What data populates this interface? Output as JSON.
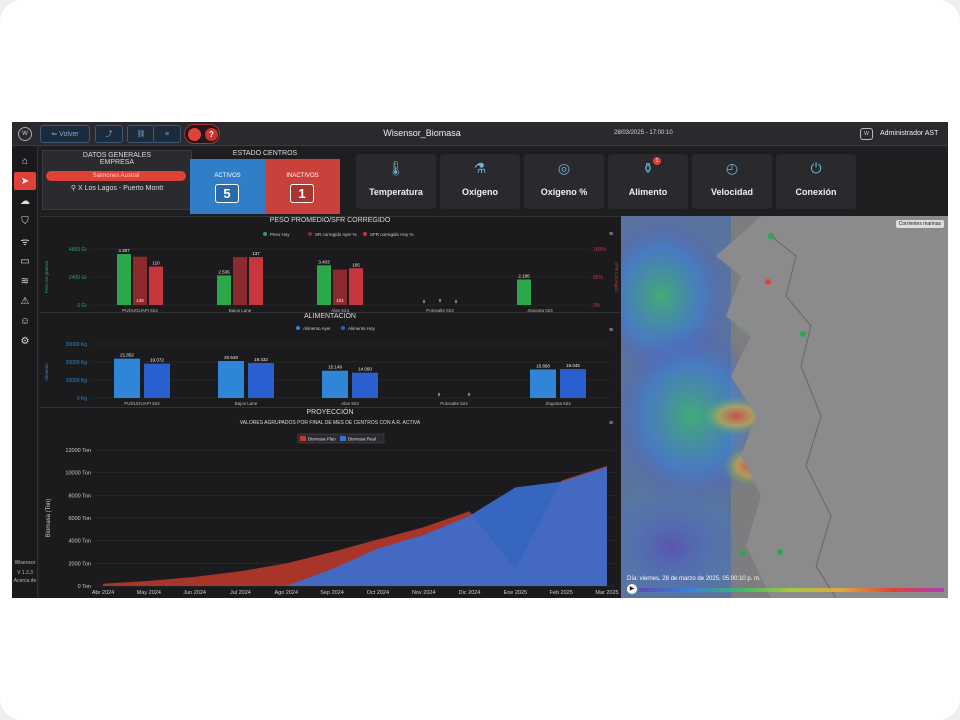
{
  "topbar": {
    "back_label": "Volver",
    "app_title": "Wisensor_Biomasa",
    "datetime": "28/03/2025 - 17:00:10",
    "user_name": "Administrador AST"
  },
  "sidebar": {
    "version_app": "Wisensor",
    "version_num": "V 1.3.3",
    "about": "Acerca de"
  },
  "datos_generales": {
    "title": "DATOS GENERALES",
    "empresa_label": "EMPRESA",
    "empresa_value": "Salmones Austral",
    "ubicacion": "X Los Lagos - Puerto Montt"
  },
  "estado_centros": {
    "title": "ESTADO CENTROS",
    "activos_label": "ACTIVOS",
    "activos_value": "5",
    "inactivos_label": "INACTIVOS",
    "inactivos_value": "1"
  },
  "sensors": [
    {
      "label": "Temperatura",
      "icon": "thermometer-icon"
    },
    {
      "label": "Oxígeno",
      "icon": "oxygen-tank-icon"
    },
    {
      "label": "Oxígeno %",
      "icon": "oxygen-percent-icon"
    },
    {
      "label": "Alimento",
      "icon": "feed-icon",
      "badge": "1"
    },
    {
      "label": "Velocidad",
      "icon": "speed-icon"
    },
    {
      "label": "Conexión",
      "icon": "power-icon"
    }
  ],
  "peso_chart": {
    "title": "PESO PROMEDIO/SFR CORREGIDO",
    "legend": [
      "Peso Hoy",
      "SR corregido Ayer %",
      "SFR corregido Hoy %"
    ],
    "y_left_ticks": [
      "4800 Gr",
      "2400 Gr",
      "0 Gr"
    ],
    "y_right_ticks": [
      "160%",
      "80%",
      "0%"
    ],
    "y_left_label": "Peso en gramos",
    "y_right_label": "SFR Corregido"
  },
  "alimentacion_chart": {
    "title": "ALIMENTACIÓN",
    "legend": [
      "Alimento Ayer",
      "Alimento Hoy"
    ],
    "y_ticks": [
      "30000 Kg",
      "20000 Kg",
      "10000 Kg",
      "0 Kg"
    ],
    "y_label": "Alimento"
  },
  "proyeccion_chart": {
    "title": "PROYECCIÓN",
    "subtitle": "VALORES AGRUPADOS POR FINAL DE MES DE CENTROS CON A.R. ACTIVA",
    "legend": [
      "Biomasa Plan",
      "Biomasa Real"
    ],
    "y_label": "Biomasa (Ton)",
    "y_ticks": [
      "12000 Ton",
      "10000 Ton",
      "8000 Ton",
      "6000 Ton",
      "4000 Ton",
      "2000 Ton",
      "0 Ton"
    ],
    "x_ticks": [
      "Abr 2024",
      "May 2024",
      "Jun 2024",
      "Jul 2024",
      "Ago 2024",
      "Sep 2024",
      "Oct 2024",
      "Nov 2024",
      "Dic 2024",
      "Ene 2025",
      "Feb 2025",
      "Mar 2025"
    ]
  },
  "map": {
    "currents_label": "Corrientes marinas",
    "date_label": "Día: viernes, 28 de marzo de 2025, 05:00:10 p. m."
  },
  "chart_data": [
    {
      "type": "bar",
      "title": "PESO PROMEDIO/SFR CORREGIDO",
      "categories": [
        "PUDUGUAPI 524",
        "Bajos Lane",
        "Alan 524",
        "Potosalte 524",
        "Jingosta 524"
      ],
      "series": [
        {
          "name": "Peso Hoy",
          "values": [
            4367,
            2536,
            3403,
            0,
            2186
          ],
          "labels": [
            "4.367",
            "2.536",
            "3.403",
            "0",
            "2.186"
          ],
          "axis": "left"
        },
        {
          "name": "SR corregido Ayer %",
          "values": [
            138,
            137,
            101,
            0,
            0
          ],
          "labels": [
            "138",
            "",
            "101",
            "0",
            ""
          ],
          "axis": "right"
        },
        {
          "name": "SFR corregido Hoy %",
          "values": [
            110,
            137,
            105,
            0,
            0
          ],
          "labels": [
            "110",
            "137",
            "105",
            "0",
            ""
          ],
          "axis": "right"
        }
      ],
      "ylim_left": [
        0,
        4800
      ],
      "ylim_right": [
        0,
        160
      ],
      "colors": [
        "#2aa84a",
        "#8c2a2f",
        "#c7363c"
      ]
    },
    {
      "type": "bar",
      "title": "ALIMENTACIÓN",
      "categories": [
        "PUDUGUAPI 524",
        "Bajos Lane",
        "Alan 524",
        "Potosalte 524",
        "Jingosta 524"
      ],
      "series": [
        {
          "name": "Alimento Ayer",
          "values": [
            21852,
            20549,
            15149,
            0,
            15858
          ],
          "labels": [
            "21.852",
            "20.549",
            "15.149",
            "0",
            "15.858"
          ]
        },
        {
          "name": "Alimento Hoy",
          "values": [
            19072,
            19432,
            14050,
            0,
            16045
          ],
          "labels": [
            "19.072",
            "19.432",
            "14.050",
            "0",
            "16.045"
          ]
        }
      ],
      "ylim": [
        0,
        30000
      ],
      "colors": [
        "#2f86d6",
        "#2a5fcf"
      ]
    },
    {
      "type": "area",
      "title": "PROYECCIÓN",
      "x": [
        "Abr 2024",
        "May 2024",
        "Jun 2024",
        "Jul 2024",
        "Ago 2024",
        "Sep 2024",
        "Oct 2024",
        "Nov 2024",
        "Dic 2024",
        "Ene 2025",
        "Feb 2025",
        "Mar 2025"
      ],
      "series": [
        {
          "name": "Biomasa Plan",
          "values": [
            200,
            450,
            800,
            1300,
            2000,
            3000,
            4100,
            5200,
            6600,
            1400,
            9300,
            10600
          ]
        },
        {
          "name": "Biomasa Real",
          "values": [
            0,
            0,
            0,
            0,
            0,
            1500,
            3300,
            4500,
            6200,
            8700,
            9200,
            10500
          ]
        }
      ],
      "ylabel": "Biomasa (Ton)",
      "ylim": [
        0,
        12000
      ],
      "colors": [
        "#c0392b",
        "#3a6fd0"
      ]
    }
  ]
}
